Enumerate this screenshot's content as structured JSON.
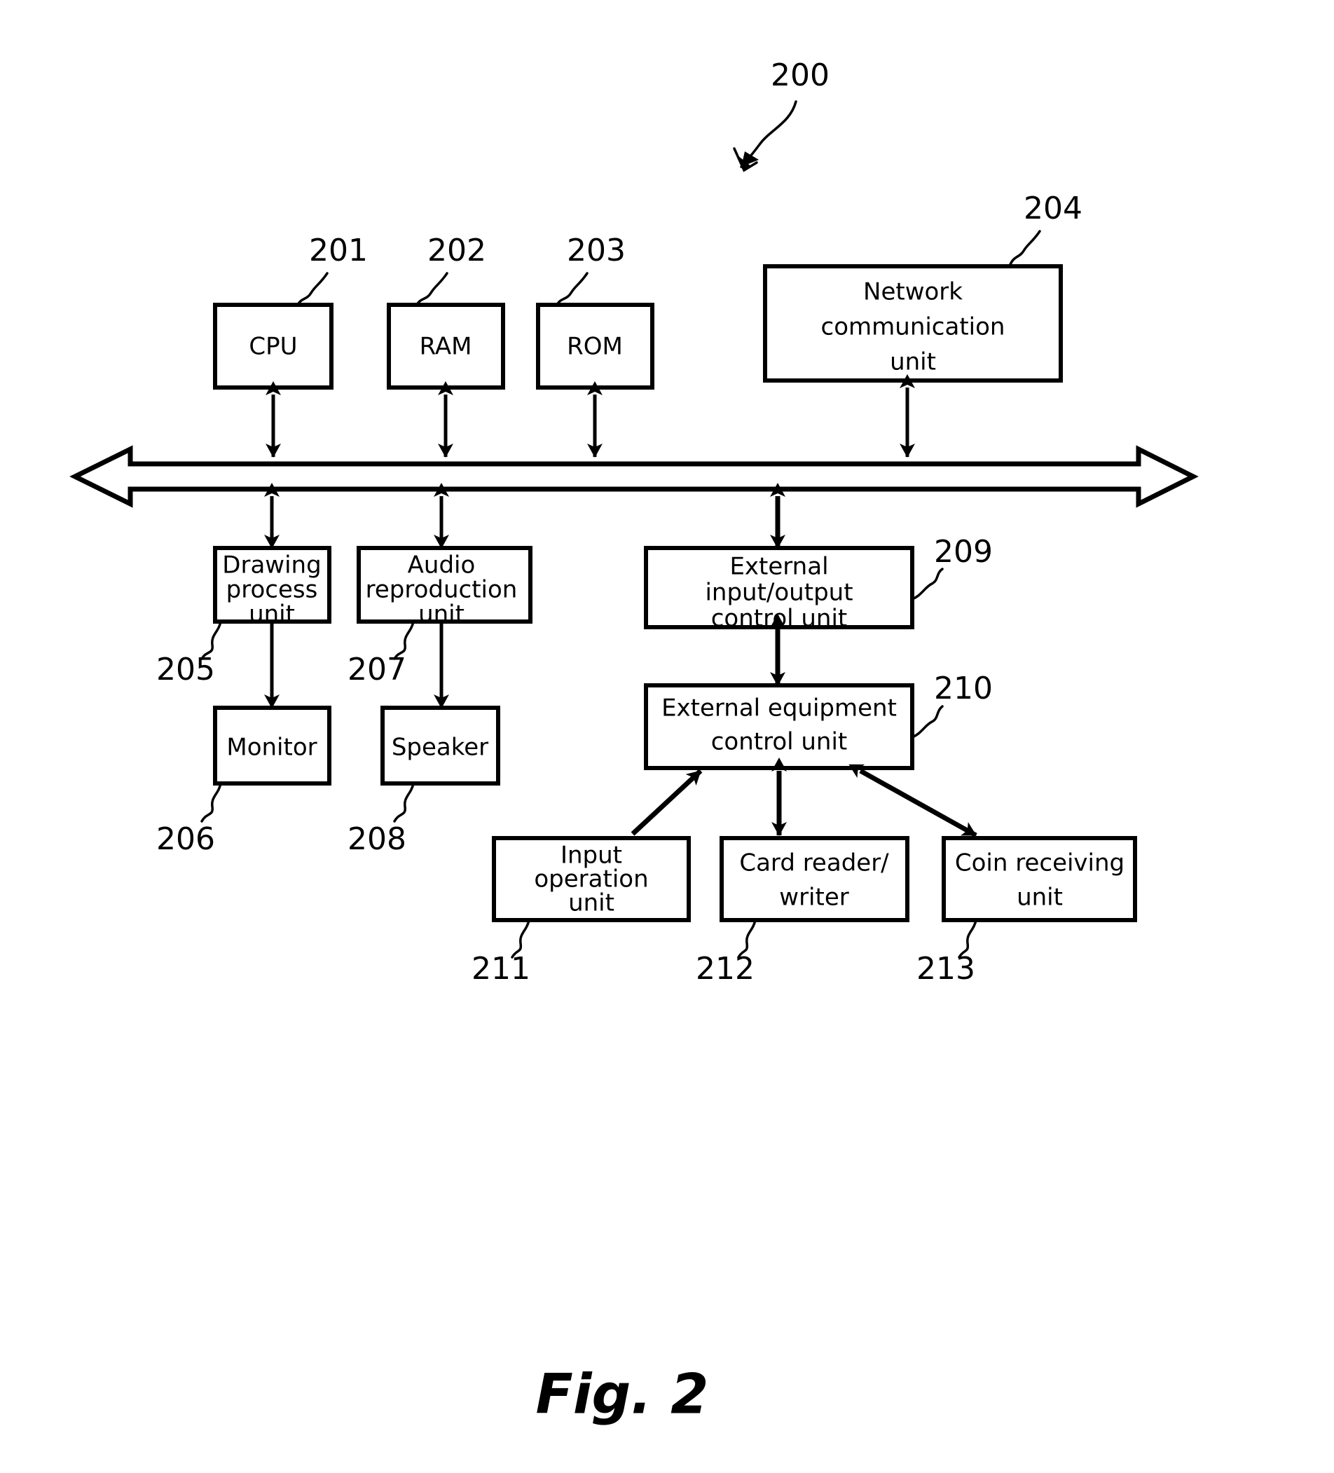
{
  "figure": {
    "caption": "Fig. 2",
    "system_ref": "200"
  },
  "blocks": {
    "cpu": {
      "label": "CPU",
      "ref": "201"
    },
    "ram": {
      "label": "RAM",
      "ref": "202"
    },
    "rom": {
      "label": "ROM",
      "ref": "203"
    },
    "network": {
      "label_line1": "Network",
      "label_line2": "communication",
      "label_line3": "unit",
      "ref": "204"
    },
    "drawing": {
      "label_line1": "Drawing",
      "label_line2": "process",
      "label_line3": "unit",
      "ref": "205"
    },
    "monitor": {
      "label": "Monitor",
      "ref": "206"
    },
    "audio": {
      "label_line1": "Audio",
      "label_line2": "reproduction",
      "label_line3": "unit",
      "ref": "207"
    },
    "speaker": {
      "label": "Speaker",
      "ref": "208"
    },
    "extio": {
      "label_line1": "External",
      "label_line2": "input/output",
      "label_line3": "control unit",
      "ref": "209"
    },
    "extequip": {
      "label_line1": "External equipment",
      "label_line2": "control unit",
      "ref": "210"
    },
    "inputop": {
      "label_line1": "Input",
      "label_line2": "operation",
      "label_line3": "unit",
      "ref": "211"
    },
    "cardreader": {
      "label_line1": "Card reader/",
      "label_line2": "writer",
      "ref": "212"
    },
    "coin": {
      "label_line1": "Coin receiving",
      "label_line2": "unit",
      "ref": "213"
    }
  },
  "colors": {
    "ink": "#000000",
    "paper": "#ffffff"
  }
}
